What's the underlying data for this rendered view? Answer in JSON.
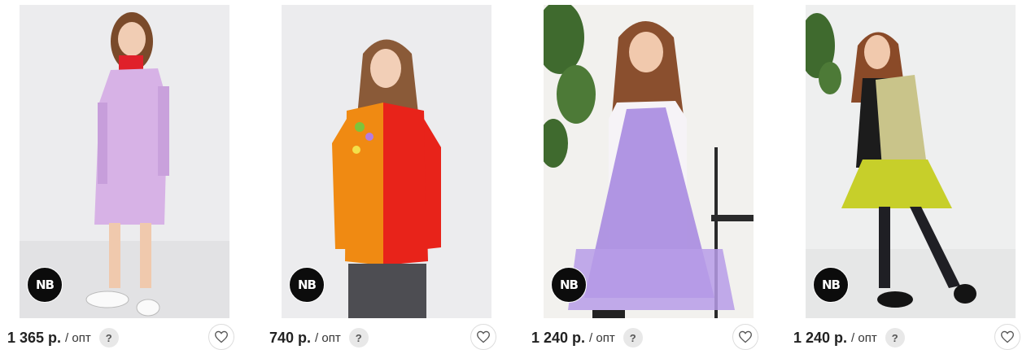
{
  "products": [
    {
      "price": "1 365 р.",
      "unit": "/ опт",
      "help": "?",
      "brand": "NB",
      "colors": {
        "bg": "#ececee",
        "floor": "#e2e2e4",
        "garment": "#d7b2e6",
        "collar": "#e0202a",
        "hair": "#7a4a2a",
        "skin": "#f1cdb4",
        "legs": "#f0c9ad"
      }
    },
    {
      "price": "740 р.",
      "unit": "/ опт",
      "help": "?",
      "brand": "NB",
      "colors": {
        "bg": "#ececee",
        "floor": "#ececee",
        "garment": "#e8231a",
        "sleeve": "#f08a12",
        "pants": "#4d4d52",
        "hair": "#8a5a38",
        "skin": "#f2cfb7"
      }
    },
    {
      "price": "1 240 р.",
      "unit": "/ опт",
      "help": "?",
      "brand": "NB",
      "colors": {
        "bg": "#f2f1ee",
        "plant": "#3f6a2e",
        "garment": "#a88be0",
        "sleeve": "#f6f3f7",
        "hair": "#8a4f2e",
        "skin": "#f1c9ad"
      }
    },
    {
      "price": "1 240 р.",
      "unit": "/ опт",
      "help": "?",
      "brand": "NB",
      "colors": {
        "bg": "#eeefef",
        "plant": "#3f6a2e",
        "garment": "#c7cf2a",
        "top": "#1c1c1c",
        "legs": "#1f1f24",
        "hair": "#8a4a28",
        "skin": "#f1c9ad"
      }
    }
  ]
}
